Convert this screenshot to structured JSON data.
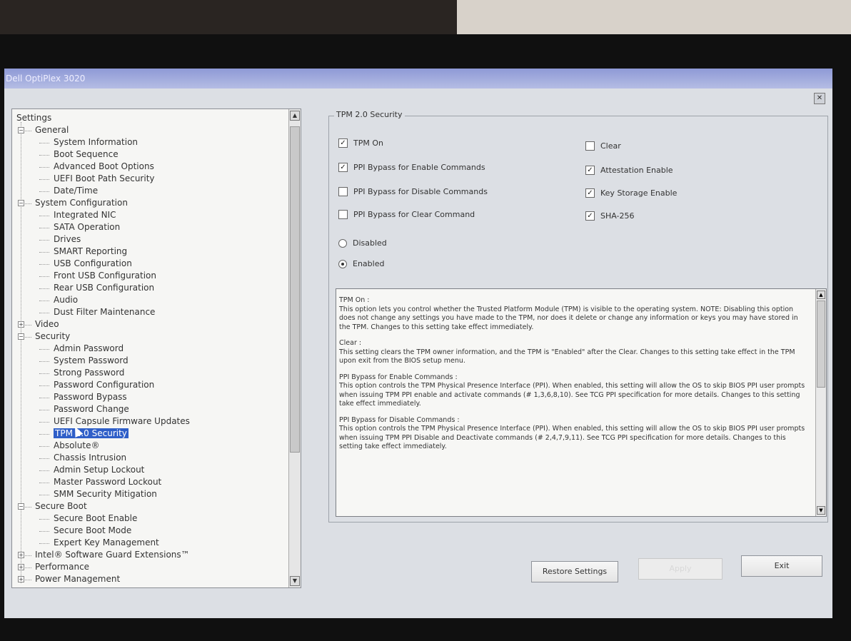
{
  "window": {
    "title": "Dell OptiPlex 3020",
    "close_label": "✕"
  },
  "tree": {
    "root": "Settings",
    "items": [
      {
        "label": "General",
        "level": 1,
        "expander": "−"
      },
      {
        "label": "System Information",
        "level": 2
      },
      {
        "label": "Boot Sequence",
        "level": 2
      },
      {
        "label": "Advanced Boot Options",
        "level": 2
      },
      {
        "label": "UEFI Boot Path Security",
        "level": 2
      },
      {
        "label": "Date/Time",
        "level": 2
      },
      {
        "label": "System Configuration",
        "level": 1,
        "expander": "−"
      },
      {
        "label": "Integrated NIC",
        "level": 2
      },
      {
        "label": "SATA Operation",
        "level": 2
      },
      {
        "label": "Drives",
        "level": 2
      },
      {
        "label": "SMART Reporting",
        "level": 2
      },
      {
        "label": "USB Configuration",
        "level": 2
      },
      {
        "label": "Front USB Configuration",
        "level": 2
      },
      {
        "label": "Rear USB Configuration",
        "level": 2
      },
      {
        "label": "Audio",
        "level": 2
      },
      {
        "label": "Dust Filter Maintenance",
        "level": 2
      },
      {
        "label": "Video",
        "level": 1,
        "expander": "+"
      },
      {
        "label": "Security",
        "level": 1,
        "expander": "−"
      },
      {
        "label": "Admin Password",
        "level": 2
      },
      {
        "label": "System Password",
        "level": 2
      },
      {
        "label": "Strong Password",
        "level": 2
      },
      {
        "label": "Password Configuration",
        "level": 2
      },
      {
        "label": "Password Bypass",
        "level": 2
      },
      {
        "label": "Password Change",
        "level": 2
      },
      {
        "label": "UEFI Capsule Firmware Updates",
        "level": 2
      },
      {
        "label": "TPM 2.0 Security",
        "level": 2,
        "selected": true
      },
      {
        "label": "Absolute®",
        "level": 2
      },
      {
        "label": "Chassis Intrusion",
        "level": 2
      },
      {
        "label": "Admin Setup Lockout",
        "level": 2
      },
      {
        "label": "Master Password Lockout",
        "level": 2
      },
      {
        "label": "SMM Security Mitigation",
        "level": 2
      },
      {
        "label": "Secure Boot",
        "level": 1,
        "expander": "−"
      },
      {
        "label": "Secure Boot Enable",
        "level": 2
      },
      {
        "label": "Secure Boot Mode",
        "level": 2
      },
      {
        "label": "Expert Key Management",
        "level": 2
      },
      {
        "label": "Intel® Software Guard Extensions™",
        "level": 1,
        "expander": "+"
      },
      {
        "label": "Performance",
        "level": 1,
        "expander": "+"
      },
      {
        "label": "Power Management",
        "level": 1,
        "expander": "+"
      }
    ]
  },
  "panel": {
    "title": "TPM 2.0 Security",
    "left_options": [
      {
        "label": "TPM On",
        "checked": true
      },
      {
        "label": "PPI Bypass for Enable Commands",
        "checked": true
      },
      {
        "label": "PPI Bypass for Disable Commands",
        "checked": false
      },
      {
        "label": "PPI Bypass for Clear Command",
        "checked": false
      }
    ],
    "right_options": [
      {
        "label": "Clear",
        "checked": false
      },
      {
        "label": "Attestation Enable",
        "checked": true
      },
      {
        "label": "Key Storage Enable",
        "checked": true
      },
      {
        "label": "SHA-256",
        "checked": true
      }
    ],
    "radios": [
      {
        "label": "Disabled",
        "selected": false
      },
      {
        "label": "Enabled",
        "selected": true
      }
    ],
    "help": [
      "TPM On :\nThis option lets you control whether the Trusted Platform Module (TPM) is visible to the operating system. NOTE: Disabling this option does not change any settings you have made to the TPM, nor does it delete or change any information or keys you may have stored in the TPM.  Changes to this setting take effect immediately.",
      "Clear :\nThis setting clears the TPM owner information, and the TPM is \"Enabled\" after the Clear.  Changes to this setting take effect in the TPM upon exit from the BIOS setup menu.",
      "PPI Bypass for Enable Commands :\nThis option controls the TPM Physical Presence Interface (PPI). When enabled, this setting will allow the OS to skip BIOS PPI user prompts when issuing TPM PPI enable and activate commands (# 1,3,6,8,10).  See TCG PPI specification for more details. Changes to this setting take effect immediately.",
      "PPI Bypass for Disable Commands :\nThis option controls the TPM Physical Presence Interface (PPI). When enabled, this setting will allow the OS to skip BIOS PPI user prompts when issuing TPM PPI Disable and Deactivate commands (# 2,4,7,9,11).  See TCG PPI specification for more details.  Changes to this setting take effect immediately."
    ]
  },
  "buttons": {
    "restore": "Restore Settings",
    "apply": "Apply",
    "exit": "Exit"
  },
  "colors": {
    "selection": "#2f5fc8",
    "titlebar": "#8e99d6"
  }
}
